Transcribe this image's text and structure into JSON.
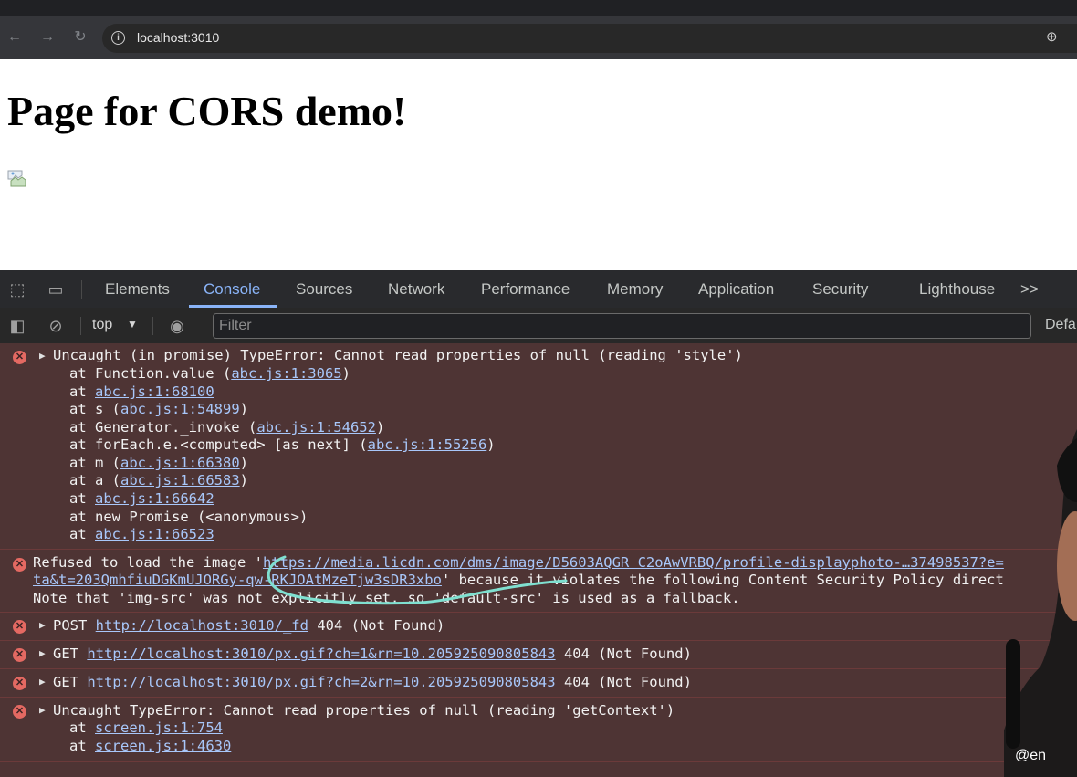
{
  "browser": {
    "url": "localhost:3010",
    "nav_icons": [
      "back-arrow-icon",
      "forward-arrow-icon",
      "reload-icon"
    ]
  },
  "page": {
    "heading": "Page for CORS demo!"
  },
  "devtools": {
    "tabs": [
      "Elements",
      "Console",
      "Sources",
      "Network",
      "Performance",
      "Memory",
      "Application",
      "Security",
      "Lighthouse"
    ],
    "active_tab": "Console",
    "more_tabs": ">>",
    "context": "top",
    "filter_placeholder": "Filter",
    "levels_label": "Defa",
    "colors": {
      "accent": "#8ab4f8",
      "error_bg": "#4e3434",
      "error_icon": "#e46962"
    }
  },
  "messages": [
    {
      "lines": [
        "Uncaught (in promise) TypeError: Cannot read properties of null (reading 'style')"
      ],
      "stack": [
        {
          "pre": "at Function.value (",
          "link": "abc.js:1:3065",
          "post": ")"
        },
        {
          "pre": "at ",
          "link": "abc.js:1:68100",
          "post": ""
        },
        {
          "pre": "at s (",
          "link": "abc.js:1:54899",
          "post": ")"
        },
        {
          "pre": "at Generator._invoke (",
          "link": "abc.js:1:54652",
          "post": ")"
        },
        {
          "pre": "at forEach.e.<computed> [as next] (",
          "link": "abc.js:1:55256",
          "post": ")"
        },
        {
          "pre": "at m (",
          "link": "abc.js:1:66380",
          "post": ")"
        },
        {
          "pre": "at a (",
          "link": "abc.js:1:66583",
          "post": ")"
        },
        {
          "pre": "at ",
          "link": "abc.js:1:66642",
          "post": ""
        },
        {
          "pre": "at new Promise (<anonymous>)",
          "link": "",
          "post": ""
        },
        {
          "pre": "at ",
          "link": "abc.js:1:66523",
          "post": ""
        }
      ]
    },
    {
      "line1_pre": "Refused to load the image '",
      "line1_link": "https://media.licdn.com/dms/image/D5603AQGR C2oAwVRBQ/profile-displayphoto-…37498537?e=",
      "line2_link": "ta&t=203QmhfiuDGKmUJORGy-qw-RKJOAtMzeTjw3sDR3xbo",
      "line2_post": "' because it violates the following Content Security Policy direct",
      "line3": "Note that 'img-src' was not explicitly set, so 'default-src' is used as a fallback."
    },
    {
      "method": "POST",
      "url": "http://localhost:3010/_fd",
      "status": "404 (Not Found)"
    },
    {
      "method": "GET",
      "url": "http://localhost:3010/px.gif?ch=1&rn=10.205925090805843",
      "status": "404 (Not Found)"
    },
    {
      "method": "GET",
      "url": "http://localhost:3010/px.gif?ch=2&rn=10.205925090805843",
      "status": "404 (Not Found)"
    },
    {
      "lines": [
        "Uncaught TypeError: Cannot read properties of null (reading 'getContext')"
      ],
      "stack": [
        {
          "pre": "at ",
          "link": "screen.js:1:754",
          "post": ""
        },
        {
          "pre": "at ",
          "link": "screen.js:1:4630",
          "post": ""
        }
      ]
    }
  ],
  "overlay": {
    "badge": "@en"
  }
}
